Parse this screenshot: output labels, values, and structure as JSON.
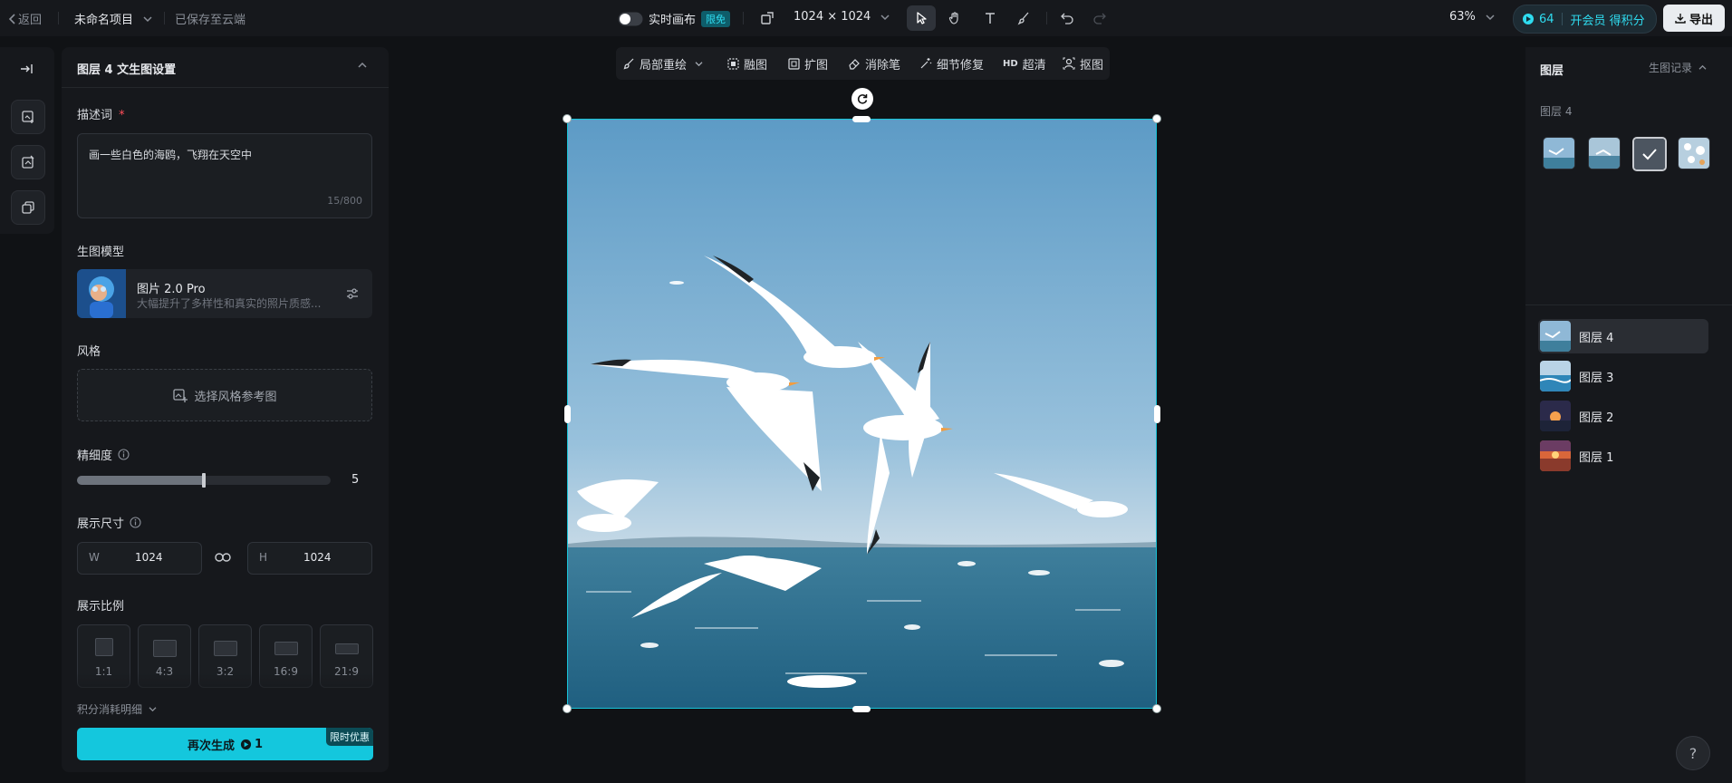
{
  "topbar": {
    "back_label": "返回",
    "project_name": "未命名项目",
    "save_status": "已保存至云端",
    "realtime_label": "实时画布",
    "realtime_tag": "限免",
    "canvas_size": "1024 × 1024",
    "zoom": "63%",
    "credits": "64",
    "member_label": "开会员 得积分",
    "export_label": "导出"
  },
  "settings": {
    "title": "图层 4 文生图设置",
    "prompt_label": "描述词",
    "prompt_required": "*",
    "prompt_text": "画一些白色的海鸥，飞翔在天空中",
    "prompt_count": "15/800",
    "model_label": "生图模型",
    "model_name": "图片 2.0 Pro",
    "model_desc": "大幅提升了多样性和真实的照片质感...",
    "style_label": "风格",
    "style_placeholder": "选择风格参考图",
    "detail_label": "精细度",
    "detail_value": "5",
    "detail_fraction": 0.5,
    "size_label": "展示尺寸",
    "width_prefix": "W",
    "width_value": "1024",
    "height_prefix": "H",
    "height_value": "1024",
    "ratio_label": "展示比例",
    "ratios": [
      "1:1",
      "4:3",
      "3:2",
      "16:9",
      "21:9"
    ],
    "credits_detail": "积分消耗明细",
    "generate_label": "再次生成",
    "generate_cost": "1",
    "promo_tag": "限时优惠"
  },
  "canvas_tools": {
    "local_redraw": "局部重绘",
    "blend": "融图",
    "expand": "扩图",
    "eraser": "消除笔",
    "detail_fix": "细节修复",
    "hd_badge": "HD",
    "upscale": "超清",
    "cutout": "抠图"
  },
  "layers_panel": {
    "title": "图层",
    "history_label": "生图记录",
    "group_label": "图层 4",
    "layers": [
      {
        "name": "图层 4"
      },
      {
        "name": "图层 3"
      },
      {
        "name": "图层 2"
      },
      {
        "name": "图层 1"
      }
    ]
  },
  "help": "?",
  "colors": {
    "accent": "#14c7dd",
    "background": "#101215",
    "panel": "#16181c"
  }
}
